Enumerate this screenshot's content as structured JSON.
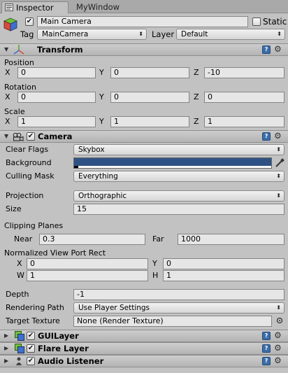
{
  "tabs": [
    {
      "label": "Inspector",
      "icon": "inspector-icon"
    },
    {
      "label": "MyWindow"
    }
  ],
  "object": {
    "name": "Main Camera",
    "static_label": "Static",
    "tag_label": "Tag",
    "tag_value": "MainCamera",
    "layer_label": "Layer",
    "layer_value": "Default",
    "icon": "gameobject-cube-icon"
  },
  "transform": {
    "title": "Transform",
    "position": {
      "label": "Position",
      "x": "0",
      "y": "0",
      "z": "-10"
    },
    "rotation": {
      "label": "Rotation",
      "x": "0",
      "y": "0",
      "z": "0"
    },
    "scale": {
      "label": "Scale",
      "x": "1",
      "y": "1",
      "z": "1"
    },
    "axis_labels": {
      "x": "X",
      "y": "Y",
      "z": "Z"
    }
  },
  "camera": {
    "title": "Camera",
    "clear_flags_label": "Clear Flags",
    "clear_flags_value": "Skybox",
    "background_label": "Background",
    "background_color": "#2f5285",
    "culling_mask_label": "Culling Mask",
    "culling_mask_value": "Everything",
    "projection_label": "Projection",
    "projection_value": "Orthographic",
    "size_label": "Size",
    "size_value": "15",
    "clipping_planes_label": "Clipping Planes",
    "near_label": "Near",
    "near_value": "0.3",
    "far_label": "Far",
    "far_value": "1000",
    "viewport_label": "Normalized View Port Rect",
    "viewport": {
      "x_label": "X",
      "x": "0",
      "y_label": "Y",
      "y": "0",
      "w_label": "W",
      "w": "1",
      "h_label": "H",
      "h": "1"
    },
    "depth_label": "Depth",
    "depth_value": "-1",
    "rendering_path_label": "Rendering Path",
    "rendering_path_value": "Use Player Settings",
    "target_texture_label": "Target Texture",
    "target_texture_value": "None (Render Texture)"
  },
  "components": [
    {
      "title": "GUILayer"
    },
    {
      "title": "Flare Layer"
    },
    {
      "title": "Audio Listener"
    }
  ],
  "colors": {
    "panel_bg": "#c2c2c2",
    "help_icon": "#3c6ea8"
  }
}
